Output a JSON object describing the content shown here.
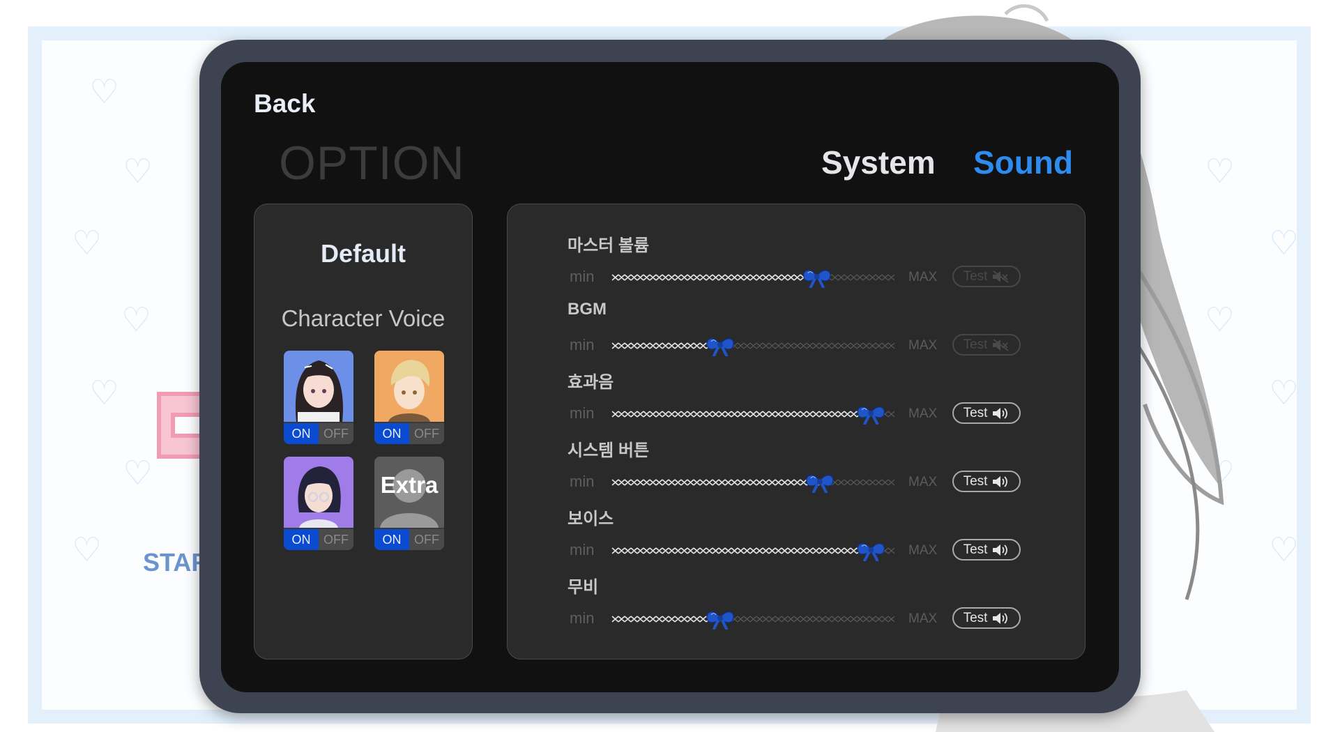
{
  "header": {
    "back_label": "Back",
    "title": "OPTION"
  },
  "tabs": [
    {
      "label": "System",
      "active": false
    },
    {
      "label": "Sound",
      "active": true
    }
  ],
  "background": {
    "start_fragment": "START",
    "o_fragment": "O"
  },
  "left_panel": {
    "default_label": "Default",
    "section_label": "Character Voice",
    "characters": [
      {
        "portrait": "dark-haired-girl-portrait",
        "on_label": "ON",
        "off_label": "OFF",
        "state": "on"
      },
      {
        "portrait": "blond-boy-portrait",
        "on_label": "ON",
        "off_label": "OFF",
        "state": "on"
      },
      {
        "portrait": "glasses-girl-portrait",
        "on_label": "ON",
        "off_label": "OFF",
        "state": "on"
      },
      {
        "portrait": "extra-silhouette",
        "extra_label": "Extra",
        "on_label": "ON",
        "off_label": "OFF",
        "state": "on"
      }
    ]
  },
  "sound": {
    "min_label": "min",
    "max_label": "MAX",
    "test_label": "Test",
    "rows": [
      {
        "label": "마스터 볼륨",
        "value": 0.72,
        "test_enabled": false
      },
      {
        "label": "BGM",
        "value": 0.38,
        "test_enabled": false
      },
      {
        "label": "효과음",
        "value": 0.91,
        "test_enabled": true
      },
      {
        "label": "시스템 버튼",
        "value": 0.73,
        "test_enabled": true
      },
      {
        "label": "보이스",
        "value": 0.91,
        "test_enabled": true
      },
      {
        "label": "무비",
        "value": 0.38,
        "test_enabled": true
      }
    ]
  },
  "colors": {
    "accent": "#2e8bf0",
    "toggle_on": "#0b4bd1",
    "ribbon": "#1f55c8"
  }
}
